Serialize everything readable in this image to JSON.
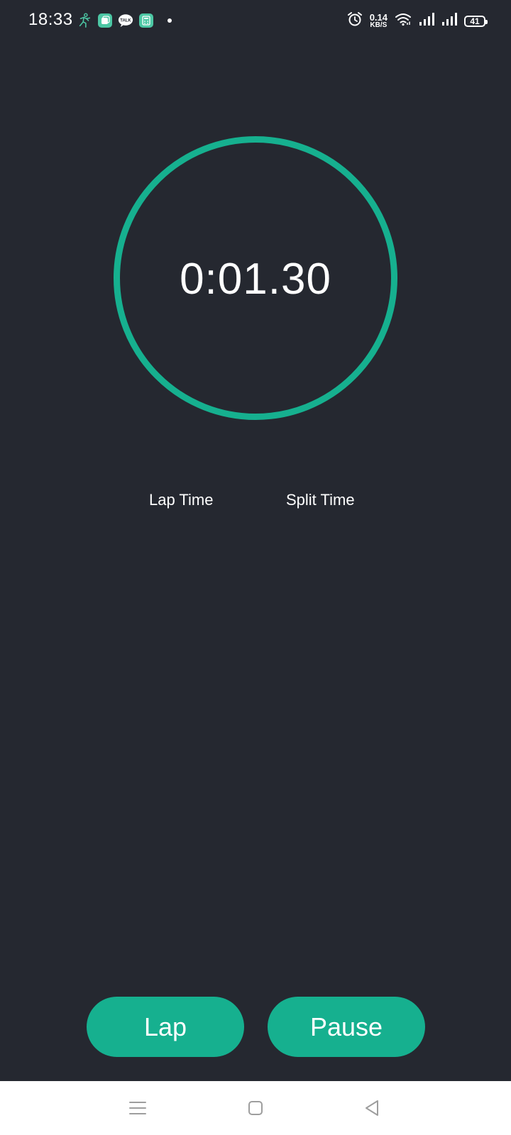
{
  "status_bar": {
    "time": "18:33",
    "network_speed_value": "0.14",
    "network_speed_unit": "KB/S",
    "battery_level": "41",
    "notification_icons": [
      "running-person-icon",
      "green-app-icon",
      "kakaotalk-icon",
      "calculator-app-icon",
      "more-notifications-dot"
    ],
    "system_icons": [
      "alarm-icon",
      "network-speed",
      "wifi-icon",
      "signal-icon",
      "signal-icon",
      "battery-icon"
    ]
  },
  "stopwatch": {
    "elapsed": "0:01.30",
    "accent_color": "#16b08f"
  },
  "columns": {
    "lap_time": "Lap Time",
    "split_time": "Split Time"
  },
  "actions": {
    "lap_label": "Lap",
    "pause_label": "Pause"
  },
  "navigation": {
    "icons": [
      "menu-icon",
      "home-icon",
      "back-icon"
    ]
  },
  "colors": {
    "background": "#252830",
    "accent": "#16b08f",
    "text": "#ffffff",
    "nav_background": "#ffffff",
    "nav_icon": "#9e9e9e"
  }
}
